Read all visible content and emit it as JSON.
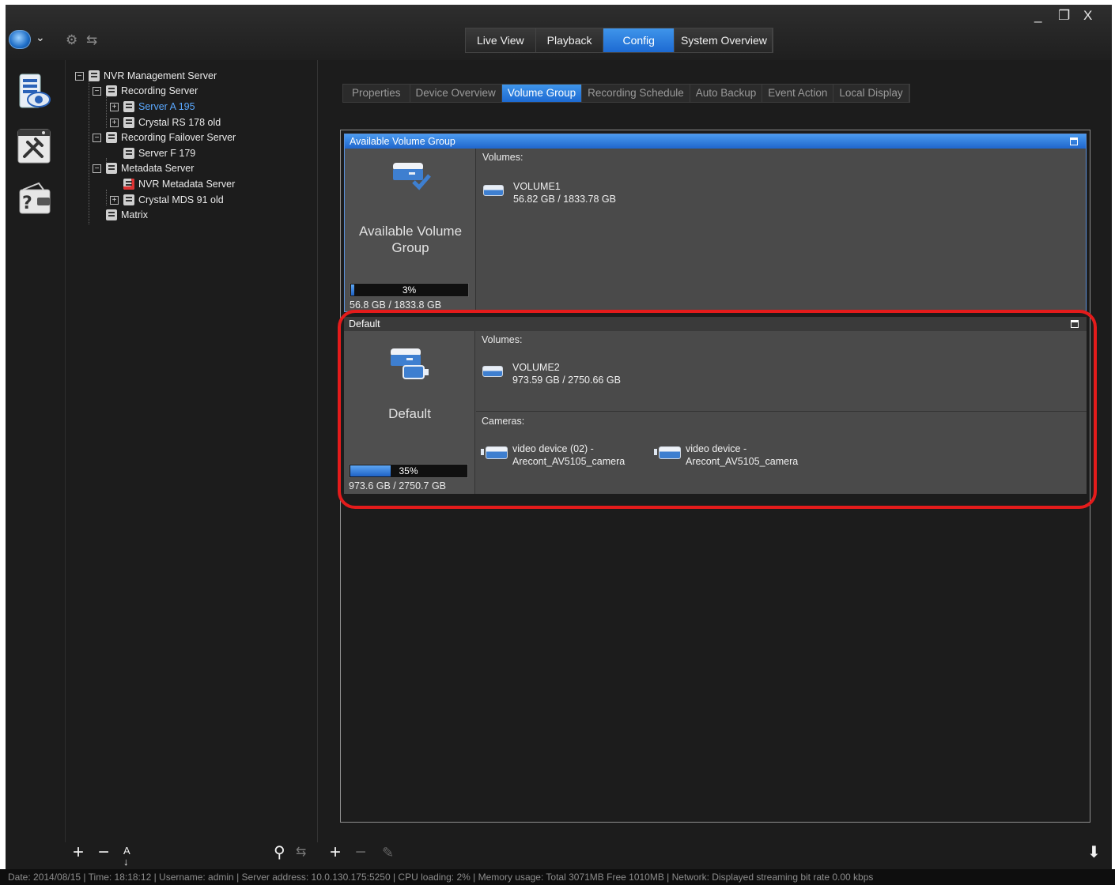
{
  "window": {
    "minimize": "_",
    "restore": "❐",
    "close": "X"
  },
  "mode_tabs": [
    {
      "label": "Live View"
    },
    {
      "label": "Playback"
    },
    {
      "label": "Config"
    },
    {
      "label": "System Overview"
    }
  ],
  "active_mode": "Config",
  "tree": {
    "root": "NVR Management Server",
    "recording_server": "Recording Server",
    "server_a": "Server A 195",
    "crystal_rs": "Crystal RS 178 old",
    "failover": "Recording Failover Server",
    "server_f": "Server F 179",
    "metadata": "Metadata Server",
    "nvr_metadata": "NVR Metadata Server",
    "crystal_mds": "Crystal MDS 91 old",
    "matrix": "Matrix"
  },
  "sub_tabs": [
    {
      "label": "Properties"
    },
    {
      "label": "Device Overview"
    },
    {
      "label": "Volume Group"
    },
    {
      "label": "Recording Schedule"
    },
    {
      "label": "Auto Backup"
    },
    {
      "label": "Event Action"
    },
    {
      "label": "Local Display"
    }
  ],
  "groups": {
    "available": {
      "header": "Available Volume Group",
      "name": "Available Volume Group",
      "percent_label": "3%",
      "percent": 0.03,
      "size": "56.8 GB / 1833.8 GB",
      "volumes_label": "Volumes:",
      "volume_name": "VOLUME1",
      "volume_size": "56.82 GB / 1833.78 GB"
    },
    "default": {
      "header": "Default",
      "name": "Default",
      "percent_label": "35%",
      "percent": 0.35,
      "size": "973.6 GB / 2750.7 GB",
      "volumes_label": "Volumes:",
      "volume_name": "VOLUME2",
      "volume_size": "973.59 GB / 2750.66 GB",
      "cameras_label": "Cameras:",
      "camera1_line1": "video device (02) -",
      "camera1_line2": "Arecont_AV5105_camera",
      "camera2_line1": "video device -",
      "camera2_line2": "Arecont_AV5105_camera"
    }
  },
  "toolbar": {
    "add": "+",
    "remove": "−",
    "sort": "A↓Z"
  },
  "status": "Date: 2014/08/15  |  Time: 18:18:12  |  Username: admin  |  Server address: 10.0.130.175:5250  |  CPU loading: 2%  |  Memory usage: Total 3071MB  Free 1010MB  |  Network: Displayed streaming bit rate    0.00 kbps",
  "colors": {
    "accent": "#1d6ad2",
    "highlight": "#e41b1b",
    "background": "#1c1c1c"
  }
}
